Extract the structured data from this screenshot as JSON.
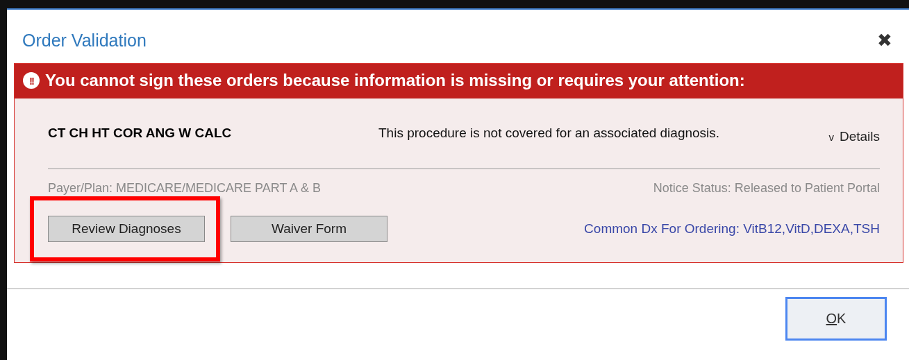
{
  "dialog": {
    "title": "Order Validation",
    "close": "✖"
  },
  "alert": {
    "icon": "!!",
    "message": "You cannot sign these orders because information is missing or requires your attention:"
  },
  "order": {
    "name": "CT CH HT COR ANG W CALC",
    "message": "This procedure is not covered for an associated diagnosis.",
    "details_caret": "v",
    "details": "Details",
    "expanded": false,
    "payer_plan": "Payer/Plan: MEDICARE/MEDICARE PART A & B",
    "notice_status": "Notice Status: Released to Patient Portal",
    "buttons": [
      {
        "label": "Review Diagnoses",
        "highlighted": true
      },
      {
        "label": "Waiver Form",
        "highlighted": false
      }
    ],
    "link": "Common Dx For Ordering: VitB12,VitD,DEXA,TSH"
  },
  "footer": {
    "ok": {
      "label": "OK",
      "first_letter_underlined": true,
      "focused": true
    }
  }
}
